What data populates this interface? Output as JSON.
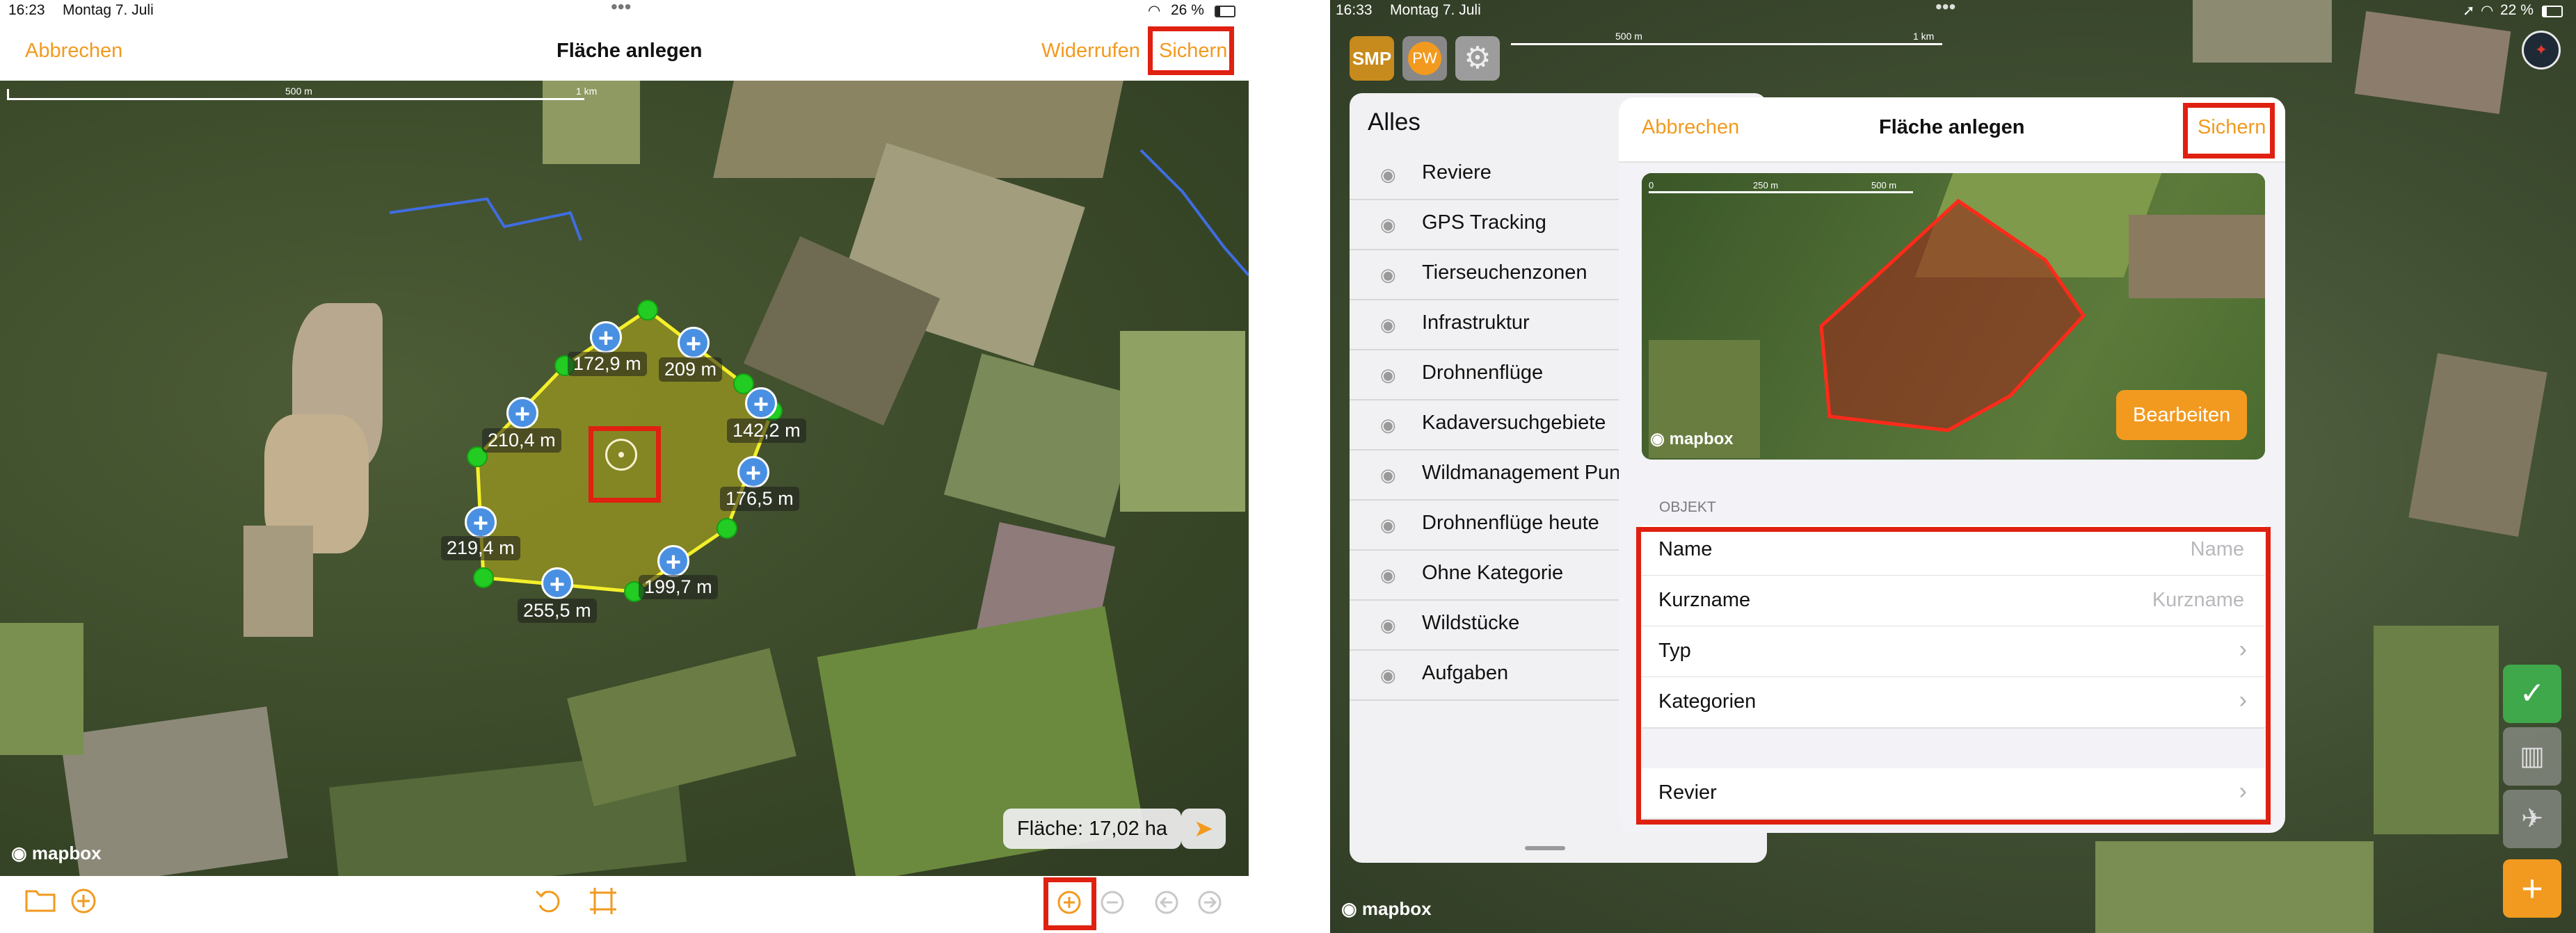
{
  "left": {
    "status": {
      "time": "16:23",
      "date": "Montag 7. Juli",
      "battery": "26 %"
    },
    "nav": {
      "cancel": "Abbrechen",
      "title": "Fläche anlegen",
      "undo": "Widerrufen",
      "save": "Sichern"
    },
    "scale": {
      "mid": "500 m",
      "end": "1 km"
    },
    "segments": [
      "172,9 m",
      "209 m",
      "142,2 m",
      "176,5 m",
      "199,7 m",
      "255,5 m",
      "219,4 m",
      "210,4 m"
    ],
    "area": "Fläche: 17,02 ha",
    "attribution": "mapbox"
  },
  "right": {
    "status": {
      "time": "16:33",
      "date": "Montag 7. Juli",
      "battery": "22 %"
    },
    "top_badges": {
      "app": "SMP",
      "user": "PW"
    },
    "scale": {
      "mid": "500 m",
      "end": "1 km"
    },
    "layers": {
      "title": "Alles",
      "items": [
        "Reviere",
        "GPS Tracking",
        "Tierseuchenzonen",
        "Infrastruktur",
        "Drohnenflüge",
        "Kadaversuchgebiete",
        "Wildmanagement Pun",
        "Drohnenflüge heute",
        "Ohne Kategorie",
        "Wildstücke",
        "Aufgaben"
      ]
    },
    "modal": {
      "cancel": "Abbrechen",
      "title": "Fläche anlegen",
      "save": "Sichern",
      "preview_scale": {
        "zero": "0",
        "mid": "250 m",
        "end": "500 m"
      },
      "preview_attribution": "mapbox",
      "edit_button": "Bearbeiten",
      "section": "OBJEKT",
      "fields": [
        {
          "label": "Name",
          "placeholder": "Name"
        },
        {
          "label": "Kurzname",
          "placeholder": "Kurzname"
        }
      ],
      "links": [
        "Typ",
        "Kategorien"
      ],
      "revier": "Revier"
    },
    "attribution": "mapbox"
  },
  "colors": {
    "accent": "#F29A1F",
    "highlight": "#E02010",
    "vertex": "#22CC22",
    "addPoint": "#4A90E2",
    "polygonFill": "#9C9A1E",
    "confirm": "#3FA84A"
  },
  "icons": [
    "folder-icon",
    "add-circle-icon",
    "rotate-icon",
    "crop-icon",
    "zoom-in-icon",
    "zoom-out-icon",
    "prev-icon",
    "next-icon",
    "location-arrow-icon",
    "compass-icon",
    "eye-icon",
    "chevron-right-icon",
    "checkmark-icon",
    "map-icon",
    "plane-icon",
    "plus-icon"
  ]
}
